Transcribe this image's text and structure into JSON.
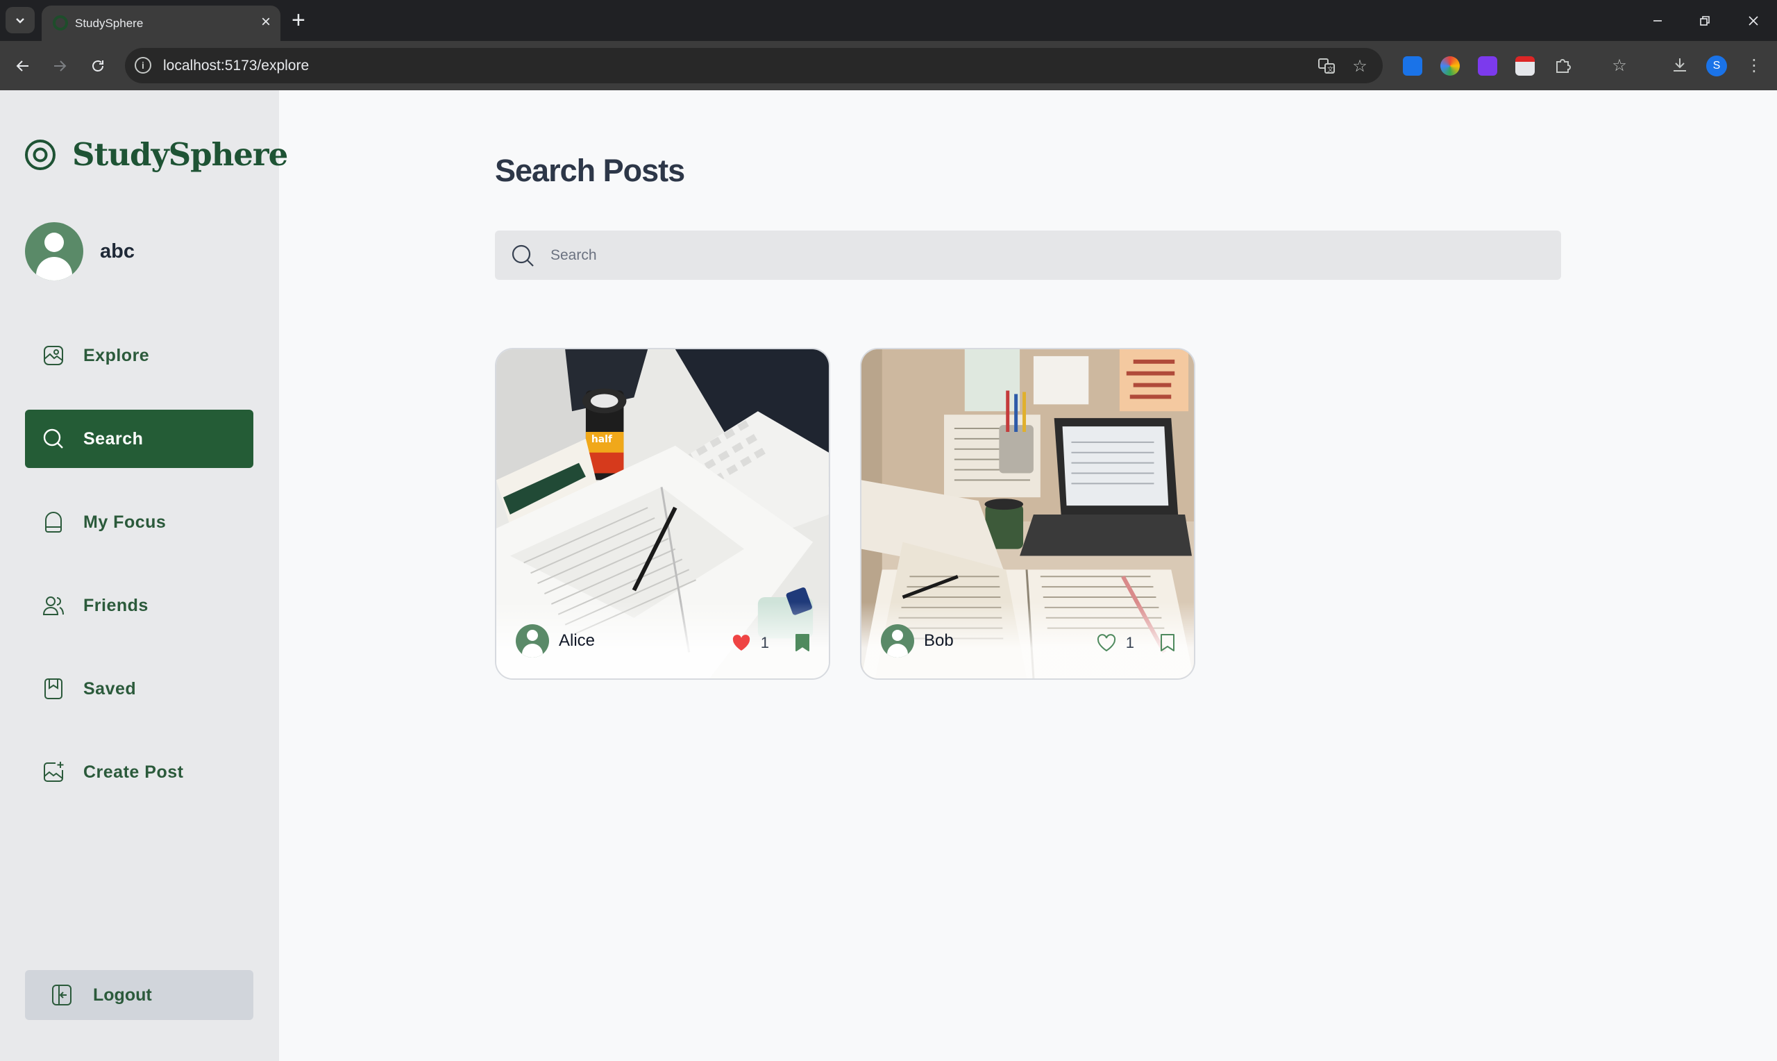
{
  "browser": {
    "tab_title": "StudySphere",
    "url": "localhost:5173/explore",
    "profile_initial": "S"
  },
  "sidebar": {
    "brand": "StudySphere",
    "username": "abc",
    "items": [
      {
        "label": "Explore",
        "icon": "explore-icon",
        "active": false
      },
      {
        "label": "Search",
        "icon": "search-icon",
        "active": true
      },
      {
        "label": "My Focus",
        "icon": "focus-icon",
        "active": false
      },
      {
        "label": "Friends",
        "icon": "friends-icon",
        "active": false
      },
      {
        "label": "Saved",
        "icon": "bookmark-icon",
        "active": false
      },
      {
        "label": "Create Post",
        "icon": "create-post-icon",
        "active": false
      }
    ],
    "logout_label": "Logout"
  },
  "main": {
    "title": "Search Posts",
    "search": {
      "placeholder": "Search",
      "value": ""
    },
    "posts": [
      {
        "author": "Alice",
        "likes": "1",
        "liked": true,
        "saved": true
      },
      {
        "author": "Bob",
        "likes": "1",
        "liked": false,
        "saved": false
      }
    ]
  },
  "colors": {
    "brand_green": "#1e5334",
    "active_nav": "#245c36",
    "like_red": "#ef4444"
  }
}
